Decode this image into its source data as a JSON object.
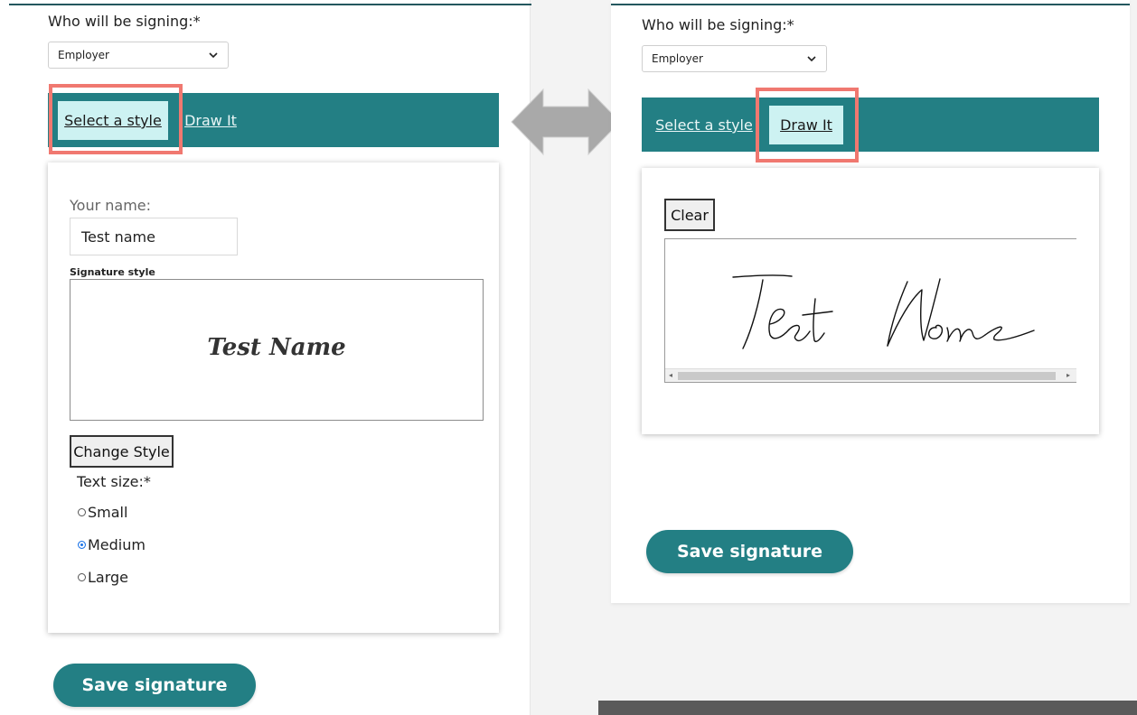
{
  "left": {
    "signer_label": "Who will be signing:*",
    "signer_select": "Employer",
    "tabs": [
      {
        "label": "Select a style",
        "active": true
      },
      {
        "label": "Draw It",
        "active": false
      }
    ],
    "name_label": "Your name:",
    "name_value": "Test name",
    "sig_style_label": "Signature style",
    "sig_preview": "Test Name",
    "change_style_button": "Change Style",
    "text_size_label": "Text size:*",
    "sizes": [
      {
        "label": "Small",
        "checked": false
      },
      {
        "label": "Medium",
        "checked": true
      },
      {
        "label": "Large",
        "checked": false
      }
    ],
    "save_button": "Save signature"
  },
  "right": {
    "signer_label": "Who will be signing:*",
    "signer_select": "Employer",
    "tabs": [
      {
        "label": "Select a style",
        "active": false
      },
      {
        "label": "Draw It",
        "active": true
      }
    ],
    "clear_button": "Clear",
    "save_button": "Save signature"
  },
  "colors": {
    "accent": "#237f84",
    "active_tab": "#cdf2f2",
    "highlight": "#f07870",
    "arrow": "#a9a9a9"
  },
  "icons": [
    "chevron-down-icon",
    "double-arrow-icon",
    "radio-icon",
    "scroll-left-icon",
    "scroll-right-icon"
  ]
}
